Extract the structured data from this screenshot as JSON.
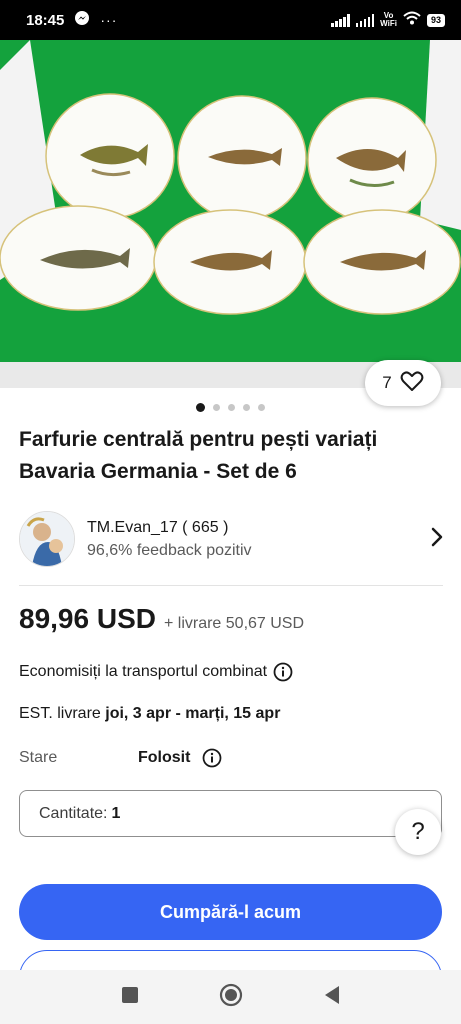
{
  "status_bar": {
    "time": "18:45",
    "more": "···",
    "vowifi_line1": "Vo",
    "vowifi_line2": "WiFi",
    "battery": "93"
  },
  "gallery": {
    "like_count": "7",
    "image_count": 5,
    "active_index": 0
  },
  "listing": {
    "title": "Farfurie centrală pentru pești variați Bavaria Germania - Set de 6"
  },
  "seller": {
    "name": "TM.Evan_17 ( 665 )",
    "feedback": "96,6% feedback pozitiv"
  },
  "pricing": {
    "price": "89,96 USD",
    "shipping": "+ livrare 50,67 USD"
  },
  "shipping_info": {
    "combined": "Economisiți la transportul combinat",
    "delivery_prefix": "EST. livrare ",
    "delivery_dates": "joi, 3 apr - marți, 15 apr"
  },
  "condition": {
    "label": "Stare",
    "value": "Folosit"
  },
  "quantity": {
    "label": "Cantitate:",
    "value": "1"
  },
  "help": {
    "label": "?"
  },
  "actions": {
    "buy_now": "Cumpără-l acum"
  },
  "colors": {
    "accent": "#3665f3",
    "photo_background": "#14a23d"
  }
}
